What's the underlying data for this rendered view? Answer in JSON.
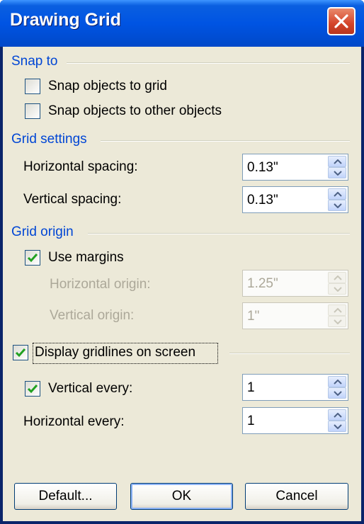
{
  "dialog": {
    "title": "Drawing Grid"
  },
  "snap_to": {
    "header": "Snap to",
    "snap_objects_to_grid": {
      "label": "Snap objects to grid",
      "checked": false
    },
    "snap_objects_to_other_objects": {
      "label": "Snap objects to other objects",
      "checked": false
    }
  },
  "grid_settings": {
    "header": "Grid settings",
    "horizontal_spacing": {
      "label": "Horizontal spacing:",
      "value": "0.13\""
    },
    "vertical_spacing": {
      "label": "Vertical spacing:",
      "value": "0.13\""
    }
  },
  "grid_origin": {
    "header": "Grid origin",
    "use_margins": {
      "label": "Use margins",
      "checked": true
    },
    "horizontal_origin": {
      "label": "Horizontal origin:",
      "value": "1.25\"",
      "enabled": false
    },
    "vertical_origin": {
      "label": "Vertical origin:",
      "value": "1\"",
      "enabled": false
    }
  },
  "display": {
    "display_gridlines": {
      "label": "Display gridlines on screen",
      "checked": true
    },
    "vertical_every": {
      "label": "Vertical every:",
      "value": "1",
      "checked": true
    },
    "horizontal_every": {
      "label": "Horizontal every:",
      "value": "1"
    }
  },
  "buttons": {
    "default": "Default...",
    "ok": "OK",
    "cancel": "Cancel"
  },
  "colors": {
    "titlebar": "#0054e3",
    "dialog_background": "#ece9d8",
    "section_header": "#0046d5",
    "checkmark": "#21a121",
    "disabled_text": "#aca899"
  },
  "icons": {
    "close": "close-x-icon",
    "check": "checkmark-icon",
    "spin_up": "arrow-up-icon",
    "spin_down": "arrow-down-icon"
  }
}
